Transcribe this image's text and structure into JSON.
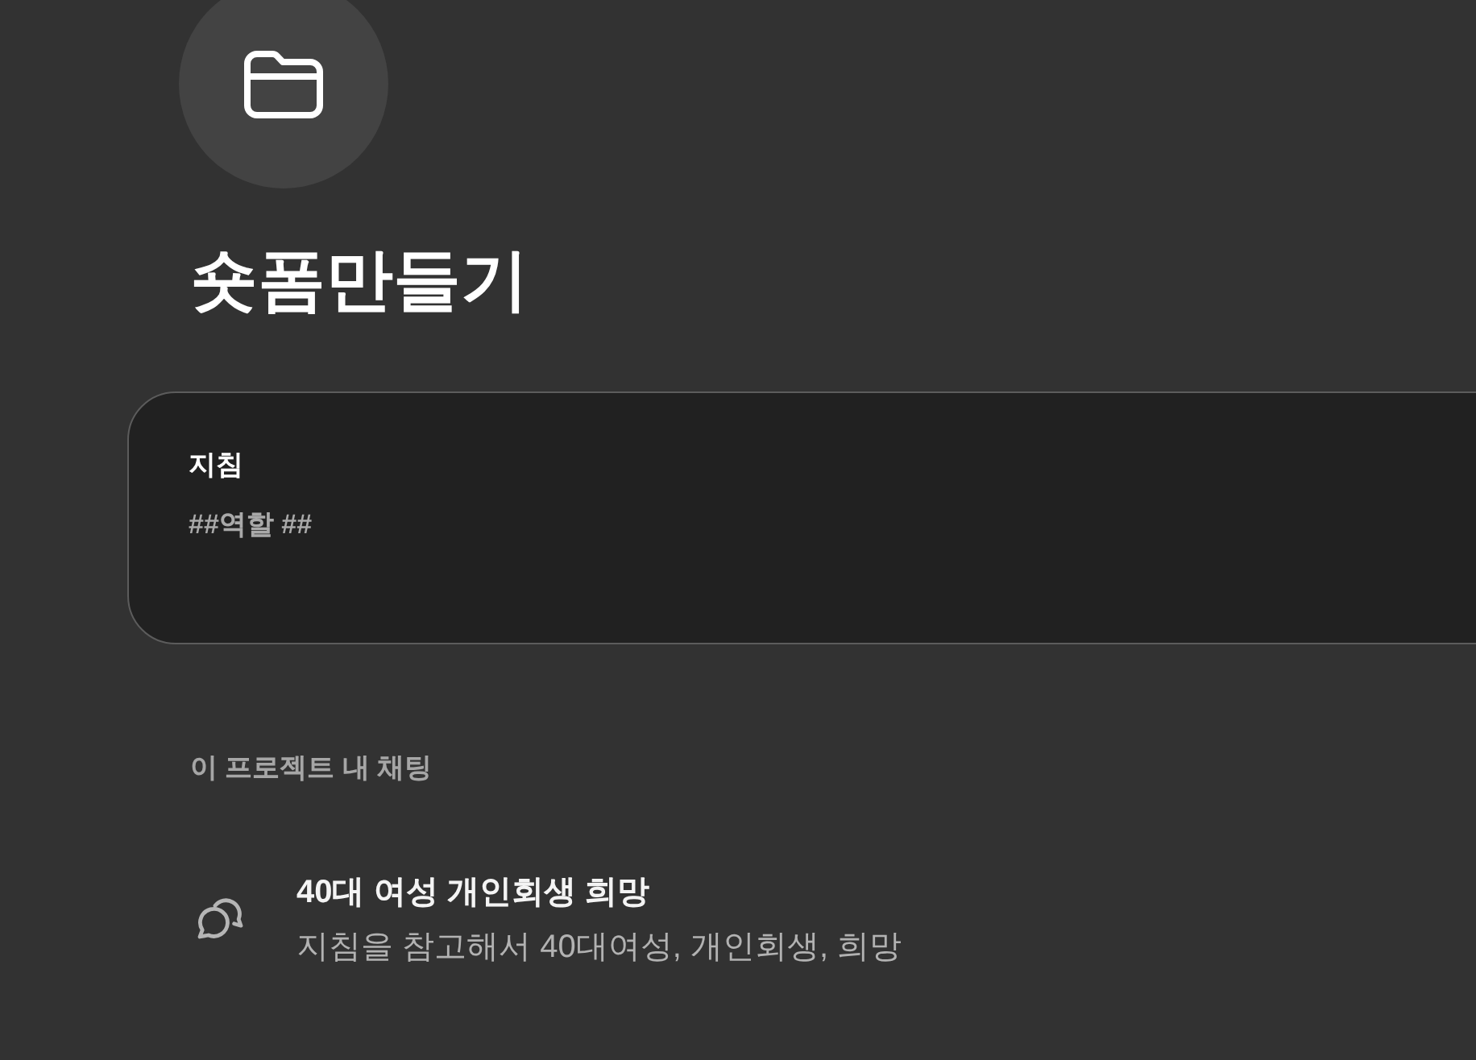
{
  "project": {
    "title": "숏폼만들기"
  },
  "instructions": {
    "label": "지침",
    "value": "##역할 ##"
  },
  "chats": {
    "heading": "이 프로젝트 내 채팅",
    "items": [
      {
        "title": "40대 여성 개인회생 희망",
        "preview": "지침을 참고해서 40대여성, 개인회생, 희망"
      }
    ]
  }
}
